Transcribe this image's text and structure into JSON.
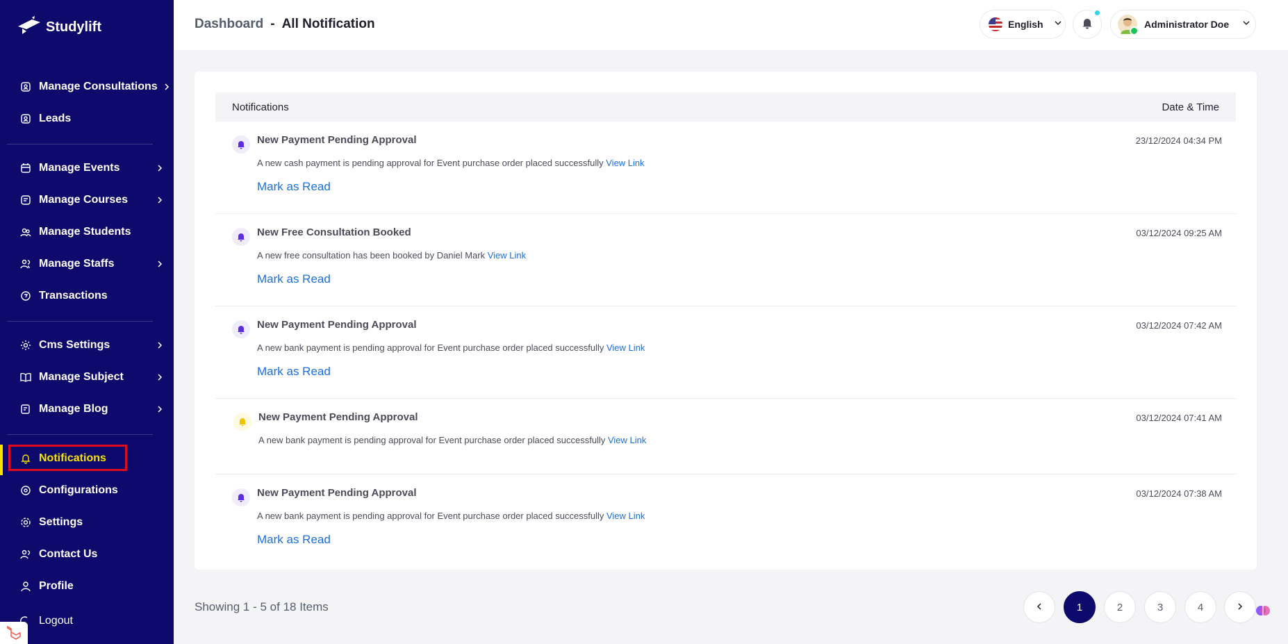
{
  "sidebar": {
    "brand": "Studylift",
    "items": [
      {
        "label": "Manage Consultations",
        "icon": "consultation-icon",
        "chevron": true
      },
      {
        "label": "Leads",
        "icon": "leads-icon",
        "chevron": false
      },
      {
        "label": "Manage Events",
        "icon": "calendar-icon",
        "chevron": true
      },
      {
        "label": "Manage Courses",
        "icon": "courses-icon",
        "chevron": true
      },
      {
        "label": "Manage Students",
        "icon": "students-icon",
        "chevron": false
      },
      {
        "label": "Manage Staffs",
        "icon": "staffs-icon",
        "chevron": true
      },
      {
        "label": "Transactions",
        "icon": "transactions-icon",
        "chevron": false
      },
      {
        "label": "Cms Settings",
        "icon": "cms-icon",
        "chevron": true
      },
      {
        "label": "Manage Subject",
        "icon": "book-icon",
        "chevron": true
      },
      {
        "label": "Manage Blog",
        "icon": "blog-icon",
        "chevron": true
      },
      {
        "label": "Notifications",
        "icon": "bell-icon",
        "chevron": false,
        "active": true
      },
      {
        "label": "Configurations",
        "icon": "configuration-icon",
        "chevron": false
      },
      {
        "label": "Settings",
        "icon": "settings-gear-icon",
        "chevron": false
      },
      {
        "label": "Contact Us",
        "icon": "contact-icon",
        "chevron": false
      },
      {
        "label": "Profile",
        "icon": "profile-icon",
        "chevron": false
      },
      {
        "label": "Logout",
        "icon": "logout-icon",
        "chevron": false
      }
    ]
  },
  "header": {
    "breadcrumb_parent": "Dashboard",
    "breadcrumb_separator": "-",
    "breadcrumb_current": "All Notification",
    "language": "English",
    "user_name": "Administrator Doe"
  },
  "table": {
    "col_notifications": "Notifications",
    "col_datetime": "Date & Time",
    "link_text": "View Link",
    "mark_read": "Mark as Read",
    "rows": [
      {
        "title": "New Payment Pending Approval",
        "desc": "A new cash payment is pending approval for Event purchase order placed successfully",
        "time": "23/12/2024 04:34 PM",
        "unread": true
      },
      {
        "title": "New Free Consultation Booked",
        "desc": "A new free consultation has been booked by Daniel Mark",
        "time": "03/12/2024 09:25 AM",
        "unread": true
      },
      {
        "title": "New Payment Pending Approval",
        "desc": "A new bank payment is pending approval for Event purchase order placed successfully",
        "time": "03/12/2024 07:42 AM",
        "unread": true
      },
      {
        "title": "New Payment Pending Approval",
        "desc": "A new bank payment is pending approval for Event purchase order placed successfully",
        "time": "03/12/2024 07:41 AM",
        "unread": false
      },
      {
        "title": "New Payment Pending Approval",
        "desc": "A new bank payment is pending approval for Event purchase order placed successfully",
        "time": "03/12/2024 07:38 AM",
        "unread": true
      }
    ]
  },
  "pagination": {
    "summary": "Showing 1 - 5 of 18 Items",
    "pages": [
      "1",
      "2",
      "3",
      "4"
    ],
    "current": "1"
  },
  "colors": {
    "sidebar_bg": "#0d0a6b",
    "active_text": "#f6e100",
    "link": "#1a6fe0",
    "highlight_border": "#e00a1e"
  }
}
